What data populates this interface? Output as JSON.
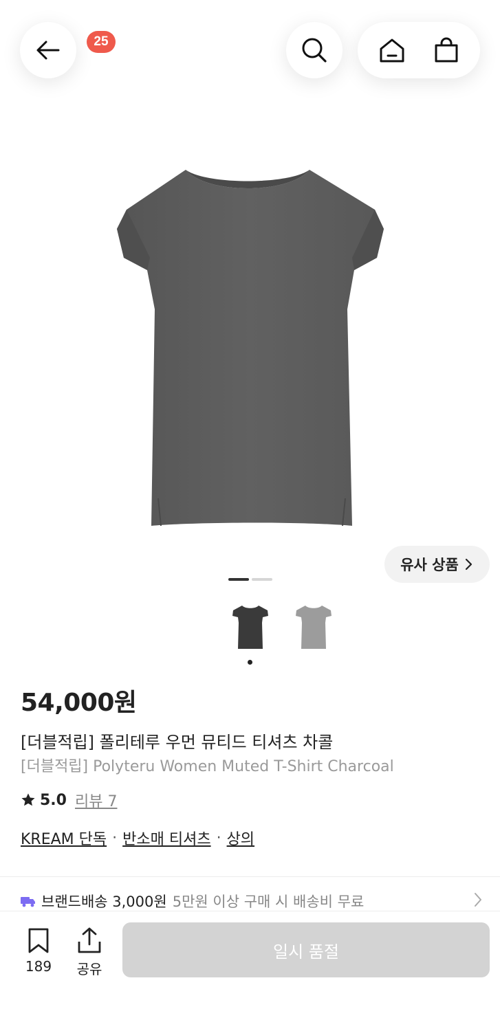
{
  "header": {
    "cart_count": "25",
    "icons": [
      "back-arrow-icon",
      "search-icon",
      "home-icon",
      "shopping-bag-icon"
    ]
  },
  "gallery": {
    "similar_label": "유사 상품",
    "indicator_count": 2,
    "active_index": 0,
    "thumbnail_colors": [
      "#3c3c3c",
      "#9a9a9a"
    ]
  },
  "product": {
    "price": "54,000원",
    "name_ko": "[더블적립] 폴리테루 우먼 뮤티드 티셔츠 차콜",
    "name_en": "[더블적립] Polyteru Women Muted T-Shirt Charcoal",
    "rating": "5.0",
    "review_label": "리뷰 7",
    "categories": [
      "KREAM 단독",
      "반소매 티셔츠",
      "상의"
    ],
    "category_separator": "·"
  },
  "shipping": {
    "label": "브랜드배송 3,000원",
    "note": "5만원 이상 구매 시 배송비 무료",
    "icon_color": "#7c6cf2"
  },
  "bottom_bar": {
    "bookmark_count": "189",
    "share_label": "공유",
    "soldout_label": "일시 품절"
  }
}
